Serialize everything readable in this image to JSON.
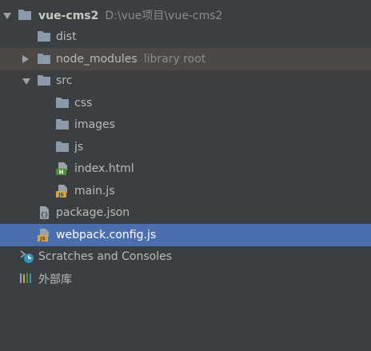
{
  "tree": {
    "root": {
      "name": "vue-cms2",
      "path": "D:\\vue项目\\vue-cms2"
    },
    "dist": "dist",
    "node_modules": {
      "name": "node_modules",
      "hint": "library root"
    },
    "src": "src",
    "css": "css",
    "images": "images",
    "js": "js",
    "index_html": "index.html",
    "main_js": "main.js",
    "package_json": "package.json",
    "webpack_config": "webpack.config.js",
    "scratches": "Scratches and Consoles",
    "external_libs": "外部库"
  },
  "colors": {
    "background": "#3c3f41",
    "selection": "#4b6eaf",
    "library_row": "#4c4843",
    "folder": "#8a9aa8",
    "js_badge": "#d6a44a",
    "html_badge": "#4b8f3a"
  },
  "icons": {
    "folder": "folder-icon",
    "js_file": "js-file-icon",
    "html_file": "html-file-icon",
    "json_file": "json-file-icon",
    "scratches": "scratches-icon",
    "libraries": "libraries-icon"
  }
}
